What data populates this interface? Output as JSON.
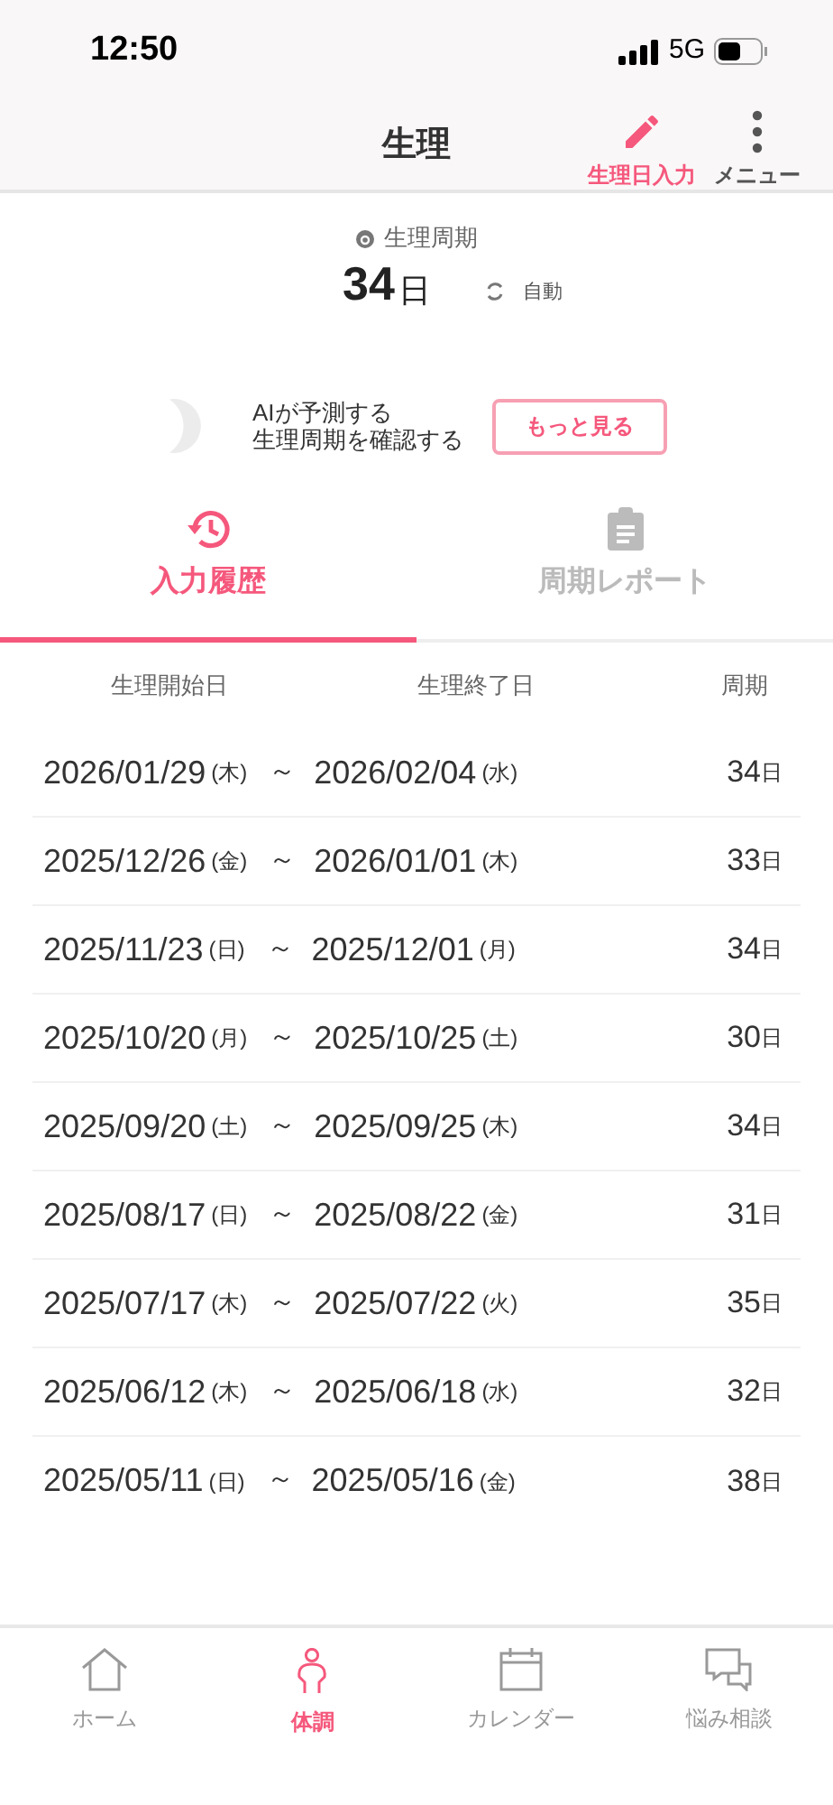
{
  "status_bar": {
    "time": "12:50",
    "network": "5G"
  },
  "header": {
    "title": "生理",
    "actions": [
      {
        "kind": "pencil",
        "label": "生理日入力",
        "selected": true
      },
      {
        "kind": "dots",
        "label": "メニュー",
        "selected": false
      }
    ]
  },
  "cycle": {
    "label": "生理周期",
    "value": "34",
    "unit": "日",
    "mode": "自動"
  },
  "ai": {
    "line1": "AIが予測する",
    "line2": "生理周期を確認する",
    "button": "もっと見る"
  },
  "tabs": [
    {
      "kind": "history",
      "label": "入力履歴",
      "selected": true
    },
    {
      "kind": "report",
      "label": "周期レポート",
      "selected": false
    }
  ],
  "table": {
    "columns": [
      "生理開始日",
      "生理終了日",
      "周期"
    ],
    "rows": [
      {
        "start": "2026/01/29",
        "start_dow": "(木)",
        "sep": "～",
        "end": "2026/02/04",
        "end_dow": "(水)",
        "cycle": "34",
        "unit": "日"
      },
      {
        "start": "2025/12/26",
        "start_dow": "(金)",
        "sep": "～",
        "end": "2026/01/01",
        "end_dow": "(木)",
        "cycle": "33",
        "unit": "日"
      },
      {
        "start": "2025/11/23",
        "start_dow": "(日)",
        "sep": "～",
        "end": "2025/12/01",
        "end_dow": "(月)",
        "cycle": "34",
        "unit": "日"
      },
      {
        "start": "2025/10/20",
        "start_dow": "(月)",
        "sep": "～",
        "end": "2025/10/25",
        "end_dow": "(土)",
        "cycle": "30",
        "unit": "日"
      },
      {
        "start": "2025/09/20",
        "start_dow": "(土)",
        "sep": "～",
        "end": "2025/09/25",
        "end_dow": "(木)",
        "cycle": "34",
        "unit": "日"
      },
      {
        "start": "2025/08/17",
        "start_dow": "(日)",
        "sep": "～",
        "end": "2025/08/22",
        "end_dow": "(金)",
        "cycle": "31",
        "unit": "日"
      },
      {
        "start": "2025/07/17",
        "start_dow": "(木)",
        "sep": "～",
        "end": "2025/07/22",
        "end_dow": "(火)",
        "cycle": "35",
        "unit": "日"
      },
      {
        "start": "2025/06/12",
        "start_dow": "(木)",
        "sep": "～",
        "end": "2025/06/18",
        "end_dow": "(水)",
        "cycle": "32",
        "unit": "日"
      },
      {
        "start": "2025/05/11",
        "start_dow": "(日)",
        "sep": "～",
        "end": "2025/05/16",
        "end_dow": "(金)",
        "cycle": "38",
        "unit": "日"
      }
    ]
  },
  "nav": [
    {
      "kind": "home",
      "label": "ホーム",
      "selected": false
    },
    {
      "kind": "person",
      "label": "体調",
      "selected": true
    },
    {
      "kind": "calendar",
      "label": "カレンダー",
      "selected": false
    },
    {
      "kind": "chat",
      "label": "悩み相談",
      "selected": false
    }
  ]
}
